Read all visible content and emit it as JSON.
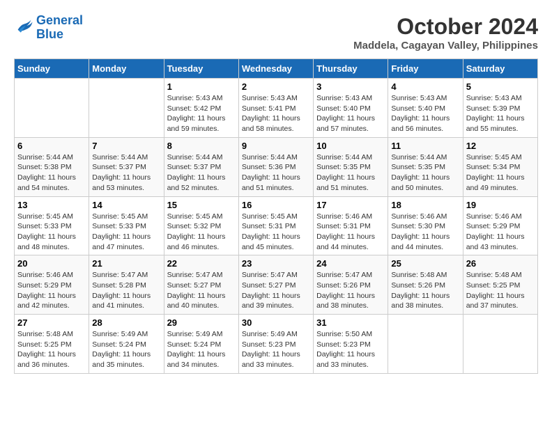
{
  "header": {
    "logo_line1": "General",
    "logo_line2": "Blue",
    "title": "October 2024",
    "subtitle": "Maddela, Cagayan Valley, Philippines"
  },
  "calendar": {
    "days_of_week": [
      "Sunday",
      "Monday",
      "Tuesday",
      "Wednesday",
      "Thursday",
      "Friday",
      "Saturday"
    ],
    "weeks": [
      [
        {
          "day": "",
          "info": ""
        },
        {
          "day": "",
          "info": ""
        },
        {
          "day": "1",
          "info": "Sunrise: 5:43 AM\nSunset: 5:42 PM\nDaylight: 11 hours and 59 minutes."
        },
        {
          "day": "2",
          "info": "Sunrise: 5:43 AM\nSunset: 5:41 PM\nDaylight: 11 hours and 58 minutes."
        },
        {
          "day": "3",
          "info": "Sunrise: 5:43 AM\nSunset: 5:40 PM\nDaylight: 11 hours and 57 minutes."
        },
        {
          "day": "4",
          "info": "Sunrise: 5:43 AM\nSunset: 5:40 PM\nDaylight: 11 hours and 56 minutes."
        },
        {
          "day": "5",
          "info": "Sunrise: 5:43 AM\nSunset: 5:39 PM\nDaylight: 11 hours and 55 minutes."
        }
      ],
      [
        {
          "day": "6",
          "info": "Sunrise: 5:44 AM\nSunset: 5:38 PM\nDaylight: 11 hours and 54 minutes."
        },
        {
          "day": "7",
          "info": "Sunrise: 5:44 AM\nSunset: 5:37 PM\nDaylight: 11 hours and 53 minutes."
        },
        {
          "day": "8",
          "info": "Sunrise: 5:44 AM\nSunset: 5:37 PM\nDaylight: 11 hours and 52 minutes."
        },
        {
          "day": "9",
          "info": "Sunrise: 5:44 AM\nSunset: 5:36 PM\nDaylight: 11 hours and 51 minutes."
        },
        {
          "day": "10",
          "info": "Sunrise: 5:44 AM\nSunset: 5:35 PM\nDaylight: 11 hours and 51 minutes."
        },
        {
          "day": "11",
          "info": "Sunrise: 5:44 AM\nSunset: 5:35 PM\nDaylight: 11 hours and 50 minutes."
        },
        {
          "day": "12",
          "info": "Sunrise: 5:45 AM\nSunset: 5:34 PM\nDaylight: 11 hours and 49 minutes."
        }
      ],
      [
        {
          "day": "13",
          "info": "Sunrise: 5:45 AM\nSunset: 5:33 PM\nDaylight: 11 hours and 48 minutes."
        },
        {
          "day": "14",
          "info": "Sunrise: 5:45 AM\nSunset: 5:33 PM\nDaylight: 11 hours and 47 minutes."
        },
        {
          "day": "15",
          "info": "Sunrise: 5:45 AM\nSunset: 5:32 PM\nDaylight: 11 hours and 46 minutes."
        },
        {
          "day": "16",
          "info": "Sunrise: 5:45 AM\nSunset: 5:31 PM\nDaylight: 11 hours and 45 minutes."
        },
        {
          "day": "17",
          "info": "Sunrise: 5:46 AM\nSunset: 5:31 PM\nDaylight: 11 hours and 44 minutes."
        },
        {
          "day": "18",
          "info": "Sunrise: 5:46 AM\nSunset: 5:30 PM\nDaylight: 11 hours and 44 minutes."
        },
        {
          "day": "19",
          "info": "Sunrise: 5:46 AM\nSunset: 5:29 PM\nDaylight: 11 hours and 43 minutes."
        }
      ],
      [
        {
          "day": "20",
          "info": "Sunrise: 5:46 AM\nSunset: 5:29 PM\nDaylight: 11 hours and 42 minutes."
        },
        {
          "day": "21",
          "info": "Sunrise: 5:47 AM\nSunset: 5:28 PM\nDaylight: 11 hours and 41 minutes."
        },
        {
          "day": "22",
          "info": "Sunrise: 5:47 AM\nSunset: 5:27 PM\nDaylight: 11 hours and 40 minutes."
        },
        {
          "day": "23",
          "info": "Sunrise: 5:47 AM\nSunset: 5:27 PM\nDaylight: 11 hours and 39 minutes."
        },
        {
          "day": "24",
          "info": "Sunrise: 5:47 AM\nSunset: 5:26 PM\nDaylight: 11 hours and 38 minutes."
        },
        {
          "day": "25",
          "info": "Sunrise: 5:48 AM\nSunset: 5:26 PM\nDaylight: 11 hours and 38 minutes."
        },
        {
          "day": "26",
          "info": "Sunrise: 5:48 AM\nSunset: 5:25 PM\nDaylight: 11 hours and 37 minutes."
        }
      ],
      [
        {
          "day": "27",
          "info": "Sunrise: 5:48 AM\nSunset: 5:25 PM\nDaylight: 11 hours and 36 minutes."
        },
        {
          "day": "28",
          "info": "Sunrise: 5:49 AM\nSunset: 5:24 PM\nDaylight: 11 hours and 35 minutes."
        },
        {
          "day": "29",
          "info": "Sunrise: 5:49 AM\nSunset: 5:24 PM\nDaylight: 11 hours and 34 minutes."
        },
        {
          "day": "30",
          "info": "Sunrise: 5:49 AM\nSunset: 5:23 PM\nDaylight: 11 hours and 33 minutes."
        },
        {
          "day": "31",
          "info": "Sunrise: 5:50 AM\nSunset: 5:23 PM\nDaylight: 11 hours and 33 minutes."
        },
        {
          "day": "",
          "info": ""
        },
        {
          "day": "",
          "info": ""
        }
      ]
    ]
  }
}
